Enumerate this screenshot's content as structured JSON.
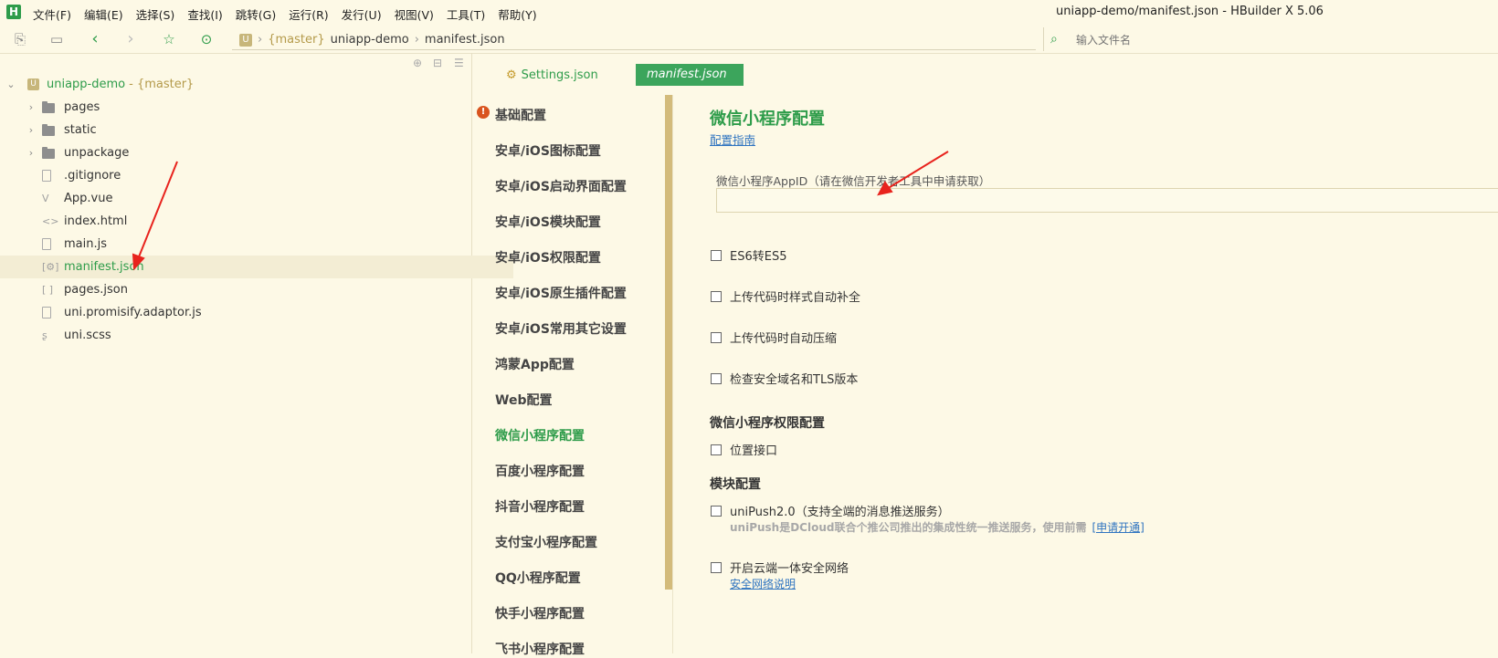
{
  "app": {
    "logo_letter": "H",
    "window_title": "uniapp-demo/manifest.json - HBuilder X 5.06"
  },
  "menu": [
    "文件(F)",
    "编辑(E)",
    "选择(S)",
    "查找(I)",
    "跳转(G)",
    "运行(R)",
    "发行(U)",
    "视图(V)",
    "工具(T)",
    "帮助(Y)"
  ],
  "toolbar": {
    "breadcrumb_branch": "{master}",
    "breadcrumb_project": "uniapp-demo",
    "breadcrumb_file": "manifest.json",
    "file_search_placeholder": "输入文件名"
  },
  "sidebar": {
    "project": {
      "name": "uniapp-demo",
      "branch": "- {master}"
    },
    "items": [
      {
        "label": "pages",
        "type": "folder"
      },
      {
        "label": "static",
        "type": "folder"
      },
      {
        "label": "unpackage",
        "type": "folder"
      },
      {
        "label": ".gitignore",
        "type": "file"
      },
      {
        "label": "App.vue",
        "type": "vue"
      },
      {
        "label": "index.html",
        "type": "html"
      },
      {
        "label": "main.js",
        "type": "file"
      },
      {
        "label": "manifest.json",
        "type": "json-config",
        "selected": true
      },
      {
        "label": "pages.json",
        "type": "json"
      },
      {
        "label": "uni.promisify.adaptor.js",
        "type": "file"
      },
      {
        "label": "uni.scss",
        "type": "scss"
      }
    ]
  },
  "tabs": {
    "settings": "Settings.json",
    "manifest": "manifest.json"
  },
  "config_nav": [
    "基础配置",
    "安卓/iOS图标配置",
    "安卓/iOS启动界面配置",
    "安卓/iOS模块配置",
    "安卓/iOS权限配置",
    "安卓/iOS原生插件配置",
    "安卓/iOS常用其它设置",
    "鸿蒙App配置",
    "Web配置",
    "微信小程序配置",
    "百度小程序配置",
    "抖音小程序配置",
    "支付宝小程序配置",
    "QQ小程序配置",
    "快手小程序配置",
    "飞书小程序配置"
  ],
  "content": {
    "title": "微信小程序配置",
    "guide_link": "配置指南",
    "appid_label": "微信小程序AppID（请在微信开发者工具中申请获取）",
    "appid_value": "",
    "checkboxes": [
      {
        "label": "ES6转ES5",
        "checked": false
      },
      {
        "label": "上传代码时样式自动补全",
        "checked": false
      },
      {
        "label": "上传代码时自动压缩",
        "checked": false
      },
      {
        "label": "检查安全域名和TLS版本",
        "checked": false
      }
    ],
    "permission_title": "微信小程序权限配置",
    "permission_item": "位置接口",
    "module_title": "模块配置",
    "unipush_label": "uniPush2.0（支持全端的消息推送服务）",
    "unipush_desc": "uniPush是DCloud联合个推公司推出的集成性统一推送服务，使用前需",
    "unipush_link": "[申请开通]",
    "secure_net_label": "开启云端一体安全网络",
    "secure_net_link": "安全网络说明"
  },
  "colors": {
    "accent": "#2e9c4a",
    "background": "#fdf9e6",
    "link": "#2f74c0",
    "annotation": "#e8231d"
  }
}
